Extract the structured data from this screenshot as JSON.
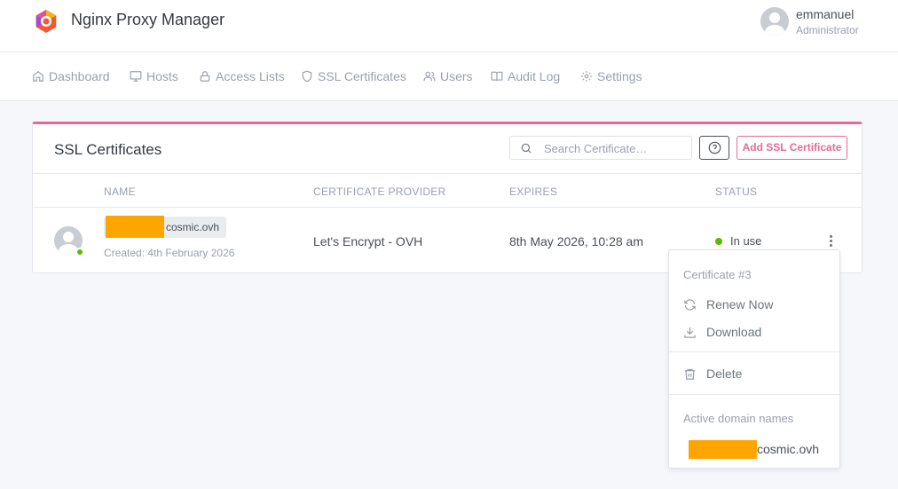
{
  "app": {
    "title": "Nginx Proxy Manager",
    "user": {
      "name": "emmanuel",
      "role": "Administrator"
    }
  },
  "nav": {
    "items": [
      {
        "label": "Dashboard",
        "icon": "home-icon"
      },
      {
        "label": "Hosts",
        "icon": "monitor-icon"
      },
      {
        "label": "Access Lists",
        "icon": "lock-icon"
      },
      {
        "label": "SSL Certificates",
        "icon": "shield-icon"
      },
      {
        "label": "Users",
        "icon": "users-icon"
      },
      {
        "label": "Audit Log",
        "icon": "book-icon"
      },
      {
        "label": "Settings",
        "icon": "gear-icon"
      }
    ]
  },
  "card": {
    "title": "SSL Certificates",
    "search_placeholder": "Search Certificate…",
    "add_label": "Add SSL Certificate",
    "accent_color": "#e56b96",
    "columns": [
      "NAME",
      "CERTIFICATE PROVIDER",
      "EXPIRES",
      "STATUS"
    ],
    "rows": [
      {
        "domain": "cosmic.ovh",
        "created": "Created: 4th February 2026",
        "provider": "Let's Encrypt - OVH",
        "expires": "8th May 2026, 10:28 am",
        "status": "In use",
        "status_color": "#5eba00"
      }
    ]
  },
  "dropdown": {
    "header": "Certificate #3",
    "renew": "Renew Now",
    "download": "Download",
    "delete": "Delete",
    "active_label": "Active domain names",
    "active_domain": "cosmic.ovh"
  },
  "redaction_color": "#ffa500"
}
